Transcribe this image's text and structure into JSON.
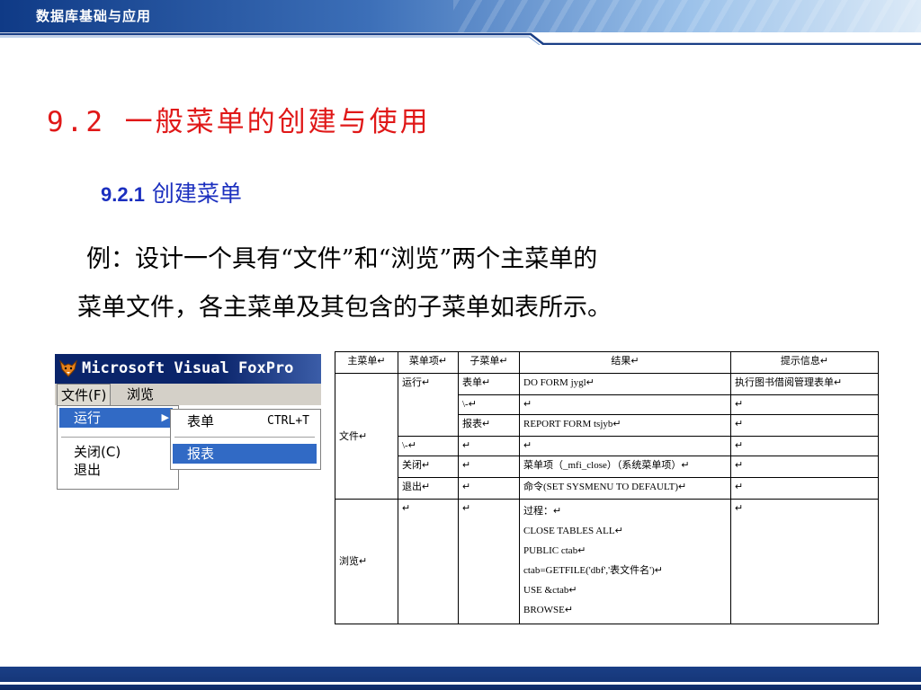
{
  "header": {
    "text": "数据库基础与应用"
  },
  "title": "9.2 一般菜单的创建与使用",
  "subtitle": {
    "number": "9.2.1",
    "text": "创建菜单"
  },
  "paragraph": {
    "line1": "例：设计一个具有“文件”和“浏览”两个主菜单的",
    "line2": "菜单文件，各主菜单及其包含的子菜单如表所示。"
  },
  "vfp": {
    "title": "Microsoft Visual FoxPro",
    "menubar": {
      "file": "文件(F)",
      "browse": "浏览"
    },
    "dropdown": {
      "run": "运行",
      "close": "关闭(C)",
      "exit": "退出"
    },
    "submenu": {
      "form": "表单",
      "form_shortcut": "CTRL+T",
      "report": "报表"
    },
    "colors": {
      "titlebar": "#0a246a",
      "highlight": "#316ac5",
      "menubar": "#d4d0c8"
    },
    "icon": "fox-icon"
  },
  "table": {
    "headers": [
      "主菜单↵",
      "菜单项↵",
      "子菜单↵",
      "结果↵",
      "提示信息↵"
    ],
    "main_file": "文件↵",
    "main_browse": "浏览↵",
    "r_run": "运行↵",
    "r_form": "表单↵",
    "r_form_result": "DO FORM jygl↵",
    "r_form_tip": "执行图书借阅管理表单↵",
    "r_sep1": "\\-↵",
    "r_report": "报表↵",
    "r_report_result": "REPORT FORM tsjyb↵",
    "r_sep2": "\\-↵",
    "r_close": "关闭↵",
    "r_close_result": "菜单项（_mfi_close）（系统菜单项）↵",
    "r_exit": "退出↵",
    "r_exit_result": "命令(SET SYSMENU TO DEFAULT)↵",
    "r_proc": [
      "过程：↵",
      "CLOSE TABLES ALL↵",
      "PUBLIC ctab↵",
      "ctab=GETFILE('dbf','表文件名')↵",
      "USE &ctab↵",
      "BROWSE↵"
    ],
    "mark": "↵"
  },
  "colors": {
    "title": "#e01818",
    "subtitle": "#1b2fbf",
    "header": "#0f3a86"
  }
}
